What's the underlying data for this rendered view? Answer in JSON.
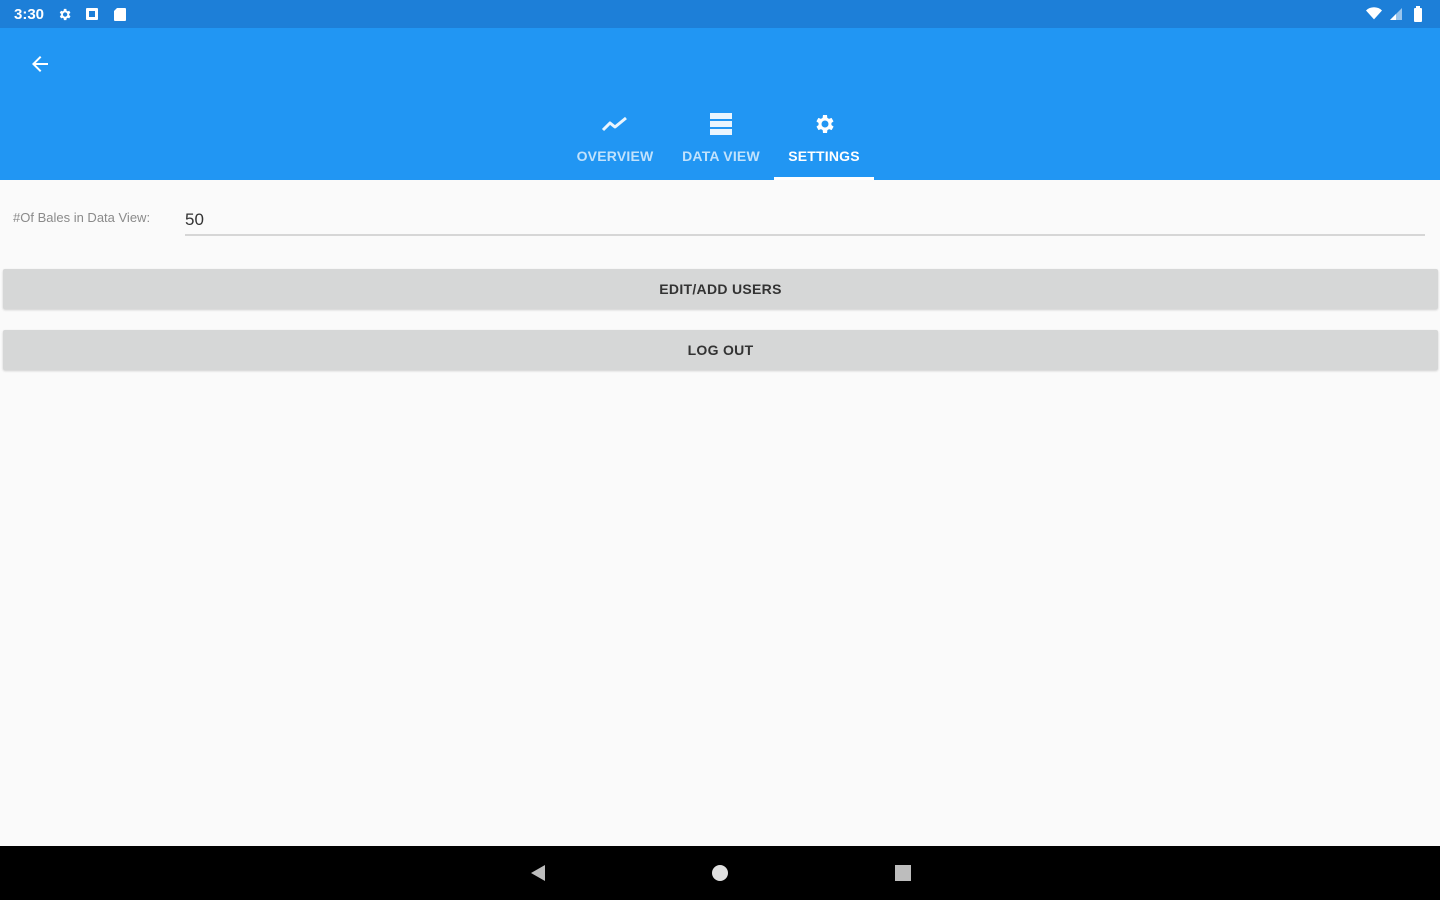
{
  "status_bar": {
    "time": "3:30",
    "left_icons": [
      "gear-icon",
      "square-icon",
      "sd-card-icon"
    ],
    "right_icons": [
      "wifi-icon",
      "signal-icon",
      "battery-icon"
    ]
  },
  "app_bar": {
    "color": "#2196f3",
    "back_icon": "arrow-left-icon",
    "tabs": [
      {
        "label": "OVERVIEW",
        "icon": "trending-up-icon",
        "active": false
      },
      {
        "label": "DATA VIEW",
        "icon": "table-icon",
        "active": false
      },
      {
        "label": "SETTINGS",
        "icon": "gear-icon",
        "active": true
      }
    ]
  },
  "settings": {
    "bales_label": "#Of Bales in Data View:",
    "bales_value": "50",
    "edit_users_label": "EDIT/ADD USERS",
    "logout_label": "LOG OUT"
  },
  "nav_bar": {
    "icons": [
      "back-triangle-icon",
      "home-circle-icon",
      "recents-square-icon"
    ]
  }
}
